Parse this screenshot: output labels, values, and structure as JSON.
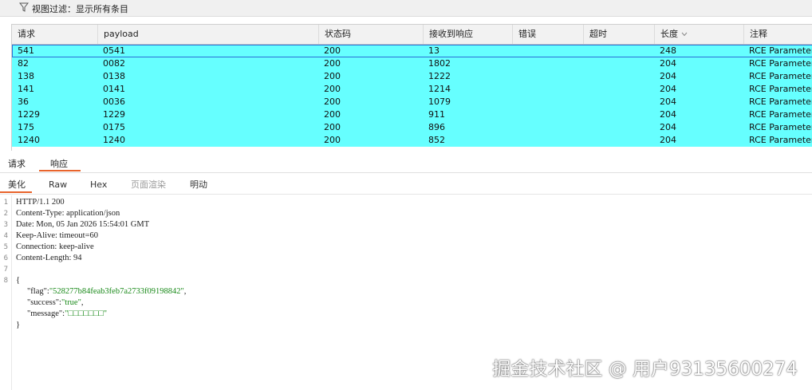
{
  "filter": {
    "icon": "funnel-icon",
    "text": "视图过滤：显示所有条目"
  },
  "table": {
    "headers": [
      "请求",
      "payload",
      "状态码",
      "接收到响应",
      "错误",
      "超时",
      "长度",
      "注释"
    ],
    "rows": [
      [
        "541",
        "0541",
        "200",
        "13",
        "",
        "",
        "248",
        "RCE Parameters"
      ],
      [
        "82",
        "0082",
        "200",
        "1802",
        "",
        "",
        "204",
        "RCE Parameters"
      ],
      [
        "138",
        "0138",
        "200",
        "1222",
        "",
        "",
        "204",
        "RCE Parameters"
      ],
      [
        "141",
        "0141",
        "200",
        "1214",
        "",
        "",
        "204",
        "RCE Parameters"
      ],
      [
        "36",
        "0036",
        "200",
        "1079",
        "",
        "",
        "204",
        "RCE Parameters"
      ],
      [
        "1229",
        "1229",
        "200",
        "911",
        "",
        "",
        "204",
        "RCE Parameters"
      ],
      [
        "175",
        "0175",
        "200",
        "896",
        "",
        "",
        "204",
        "RCE Parameters"
      ],
      [
        "1240",
        "1240",
        "200",
        "852",
        "",
        "",
        "204",
        "RCE Parameters"
      ]
    ],
    "row_color": "#66ffff"
  },
  "main_tabs": [
    "请求",
    "响应"
  ],
  "view_tabs": [
    "美化",
    "Raw",
    "Hex",
    "页面渲染",
    "明动"
  ],
  "editor": {
    "line_numbers": [
      "1",
      "2",
      "3",
      "4",
      "5",
      "6",
      "7",
      "8"
    ],
    "lines": [
      "HTTP/1.1 200",
      "Content-Type: application/json",
      "Date: Mon, 05 Jan 2026 15:54:01 GMT",
      "Keep-Alive: timeout=60",
      "Connection: keep-alive",
      "Content-Length: 94",
      "",
      "{"
    ],
    "json_body": {
      "flag_key": "\"flag\":",
      "flag_val": "\"528277b84feab3feb7a2733f09198842\"",
      "success_key": "\"success\":",
      "success_val": "\"true\"",
      "message_key": "\"message\":",
      "message_val": "\"□□□□□□□\"",
      "close": "}"
    }
  },
  "watermark": "掘金技术社区 @ 用户93135600274",
  "accent_color": "#e8642c"
}
